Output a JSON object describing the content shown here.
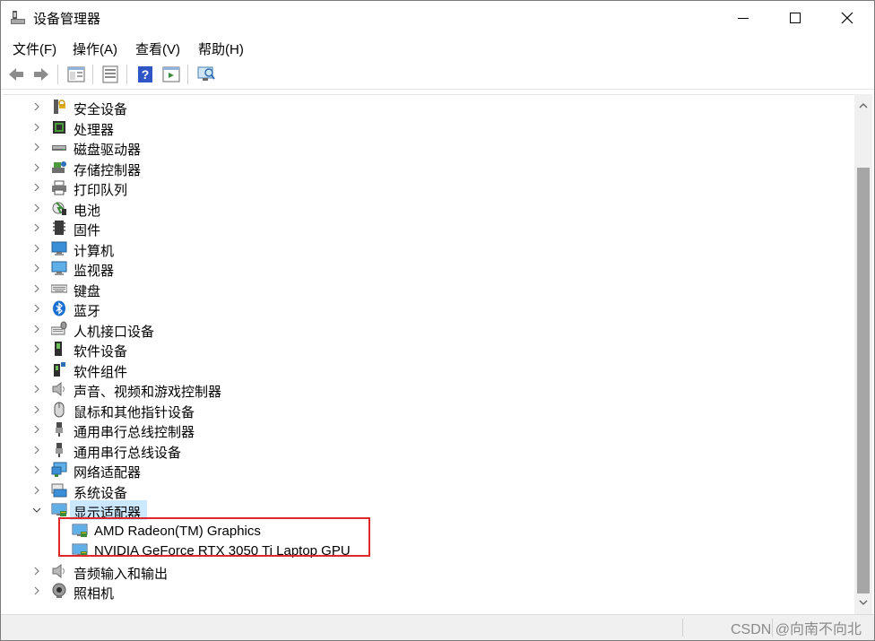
{
  "window": {
    "title": "设备管理器",
    "title_icon": "device-manager-icon"
  },
  "menu": [
    {
      "label": "文件(F)"
    },
    {
      "label": "操作(A)"
    },
    {
      "label": "查看(V)"
    },
    {
      "label": "帮助(H)"
    }
  ],
  "toolbar": {
    "buttons": [
      "back-icon",
      "forward-icon",
      "show-hide-tree-icon",
      "properties-icon",
      "help-icon",
      "action-pane-icon",
      "scan-hardware-icon"
    ]
  },
  "tree": {
    "categories": [
      {
        "label": "安全设备",
        "icon": "security-device-icon",
        "expanded": false
      },
      {
        "label": "处理器",
        "icon": "processor-icon",
        "expanded": false
      },
      {
        "label": "磁盘驱动器",
        "icon": "disk-drive-icon",
        "expanded": false
      },
      {
        "label": "存储控制器",
        "icon": "storage-controller-icon",
        "expanded": false
      },
      {
        "label": "打印队列",
        "icon": "printer-icon",
        "expanded": false
      },
      {
        "label": "电池",
        "icon": "battery-icon",
        "expanded": false
      },
      {
        "label": "固件",
        "icon": "firmware-icon",
        "expanded": false
      },
      {
        "label": "计算机",
        "icon": "computer-icon",
        "expanded": false
      },
      {
        "label": "监视器",
        "icon": "monitor-icon",
        "expanded": false
      },
      {
        "label": "键盘",
        "icon": "keyboard-icon",
        "expanded": false
      },
      {
        "label": "蓝牙",
        "icon": "bluetooth-icon",
        "expanded": false
      },
      {
        "label": "人机接口设备",
        "icon": "hid-icon",
        "expanded": false
      },
      {
        "label": "软件设备",
        "icon": "software-device-icon",
        "expanded": false
      },
      {
        "label": "软件组件",
        "icon": "software-component-icon",
        "expanded": false
      },
      {
        "label": "声音、视频和游戏控制器",
        "icon": "speaker-icon",
        "expanded": false
      },
      {
        "label": "鼠标和其他指针设备",
        "icon": "mouse-icon",
        "expanded": false
      },
      {
        "label": "通用串行总线控制器",
        "icon": "usb-icon",
        "expanded": false
      },
      {
        "label": "通用串行总线设备",
        "icon": "usb-icon",
        "expanded": false
      },
      {
        "label": "网络适配器",
        "icon": "network-adapter-icon",
        "expanded": false
      },
      {
        "label": "系统设备",
        "icon": "system-device-icon",
        "expanded": false
      },
      {
        "label": "显示适配器",
        "icon": "display-adapter-icon",
        "expanded": true,
        "selected": true,
        "children": [
          {
            "label": "AMD Radeon(TM) Graphics",
            "icon": "display-adapter-icon"
          },
          {
            "label": "NVIDIA GeForce RTX 3050 Ti Laptop GPU",
            "icon": "display-adapter-icon"
          }
        ]
      },
      {
        "label": "音频输入和输出",
        "icon": "audio-io-icon",
        "expanded": false
      },
      {
        "label": "照相机",
        "icon": "camera-icon",
        "expanded": false
      }
    ]
  },
  "watermark": "CSDN @向南不向北",
  "colors": {
    "selection": "#cce8ff",
    "highlight_box": "#e0282c"
  }
}
